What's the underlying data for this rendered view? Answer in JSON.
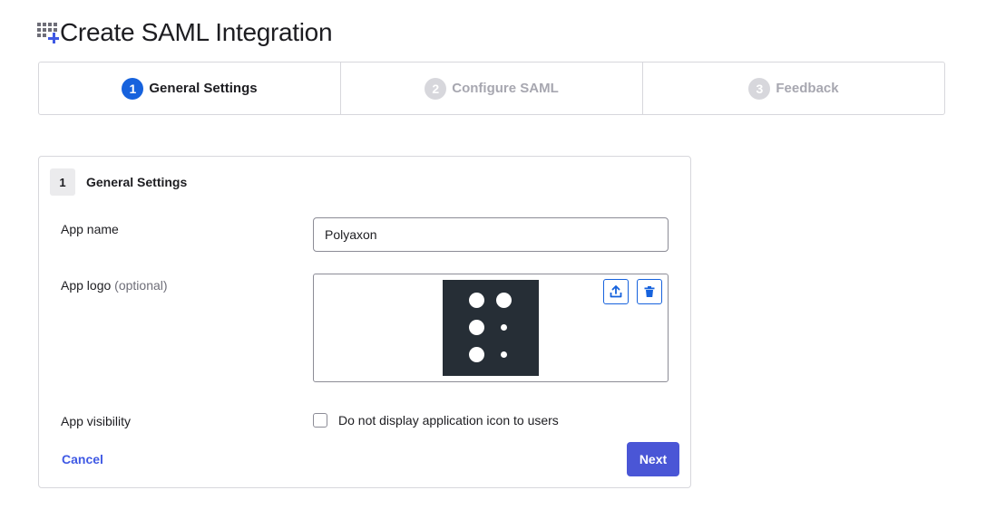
{
  "page": {
    "title": "Create SAML Integration",
    "icon": "app-grid-plus-icon"
  },
  "wizard": {
    "steps": [
      {
        "number": "1",
        "label": "General Settings",
        "state": "active"
      },
      {
        "number": "2",
        "label": "Configure SAML",
        "state": "inactive"
      },
      {
        "number": "3",
        "label": "Feedback",
        "state": "inactive"
      }
    ]
  },
  "form": {
    "section_number": "1",
    "section_title": "General Settings",
    "app_name": {
      "label": "App name",
      "value": "Polyaxon"
    },
    "app_logo": {
      "label": "App logo",
      "optional_text": "(optional)",
      "upload_icon": "upload-icon",
      "delete_icon": "trash-icon"
    },
    "app_visibility": {
      "label": "App visibility",
      "checkbox_label": "Do not display application icon to users",
      "checked": false
    },
    "actions": {
      "cancel_label": "Cancel",
      "next_label": "Next"
    }
  },
  "colors": {
    "accent_blue": "#1662dd",
    "button_primary": "#4a56d6",
    "link": "#3f59e4",
    "logo_bg": "#262e36"
  }
}
